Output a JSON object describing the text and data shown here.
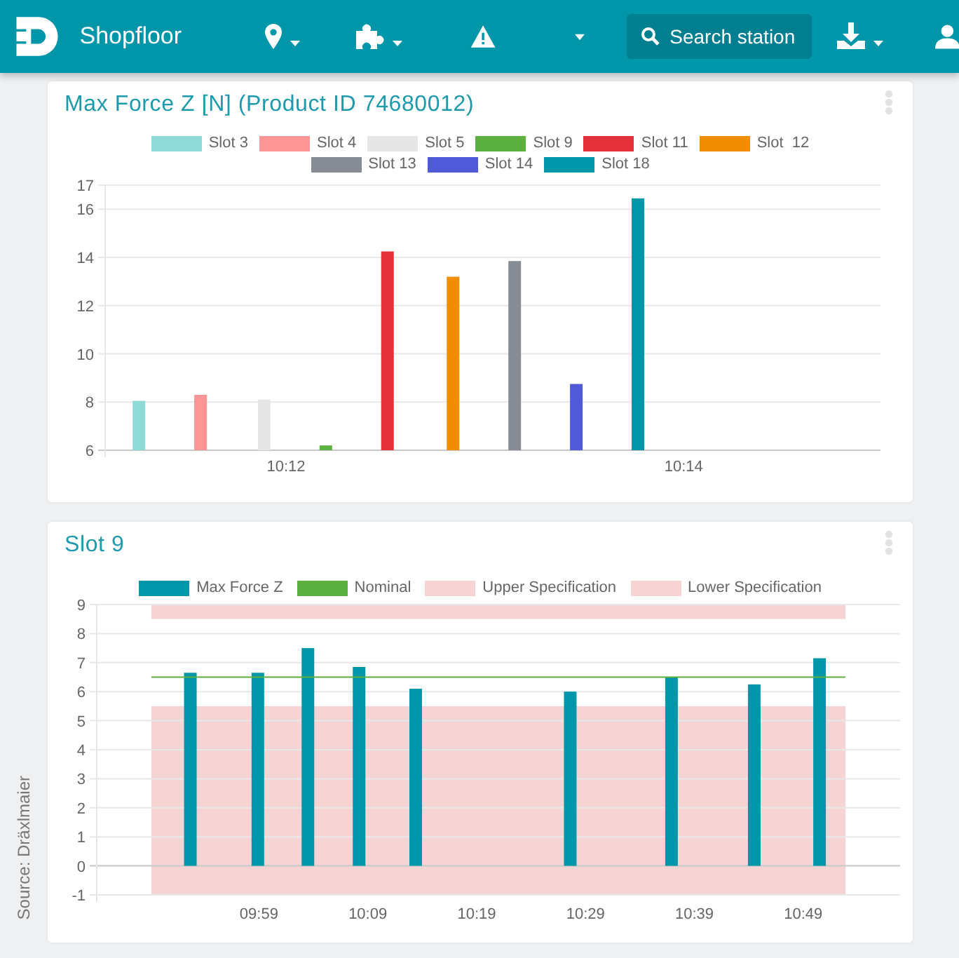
{
  "navbar": {
    "brand": "Shopfloor",
    "search": {
      "placeholder": "Search station"
    }
  },
  "cards": [
    {
      "title": "Max Force Z [N] (Product ID 74680012)",
      "chart_data": {
        "type": "bar",
        "x": [
          611.26,
          611.57,
          611.89,
          612.2,
          612.51,
          612.84,
          613.15,
          613.46,
          613.77
        ],
        "xlim": [
          611.09,
          614.99
        ],
        "ylim": [
          6,
          17
        ],
        "grid": true,
        "yticks": [
          6,
          8,
          10,
          12,
          14,
          16,
          17
        ],
        "xticks": [
          {
            "value": 612,
            "label": "10:12"
          },
          {
            "value": 614,
            "label": "10:14"
          }
        ],
        "series": [
          {
            "name": "Slot 3",
            "color": "#8fd9d6",
            "values": [
              8.05,
              null,
              null,
              null,
              null,
              null,
              null,
              null,
              null
            ]
          },
          {
            "name": "Slot 4",
            "color": "#fc9596",
            "values": [
              null,
              8.3,
              null,
              null,
              null,
              null,
              null,
              null,
              null
            ]
          },
          {
            "name": "Slot 5",
            "color": "#e6e6e6",
            "values": [
              null,
              null,
              8.1,
              null,
              null,
              null,
              null,
              null,
              null
            ]
          },
          {
            "name": "Slot 9",
            "color": "#5cb040",
            "values": [
              null,
              null,
              null,
              6.2,
              null,
              null,
              null,
              null,
              null
            ]
          },
          {
            "name": "Slot 11",
            "color": "#e4303a",
            "values": [
              null,
              null,
              null,
              null,
              14.25,
              null,
              null,
              null,
              null
            ]
          },
          {
            "name": "Slot  12",
            "color": "#f28c00",
            "values": [
              null,
              null,
              null,
              null,
              null,
              13.2,
              null,
              null,
              null
            ]
          },
          {
            "name": "Slot 13",
            "color": "#878c94",
            "values": [
              null,
              null,
              null,
              null,
              null,
              null,
              13.85,
              null,
              null
            ]
          },
          {
            "name": "Slot 14",
            "color": "#5059d8",
            "values": [
              null,
              null,
              null,
              null,
              null,
              null,
              null,
              8.75,
              null
            ]
          },
          {
            "name": "Slot 18",
            "color": "#0096aa",
            "values": [
              null,
              null,
              null,
              null,
              null,
              null,
              null,
              null,
              16.45
            ]
          }
        ]
      }
    },
    {
      "title": "Slot 9",
      "chart_data": {
        "type": "bar",
        "x": [
          592.7,
          598.9,
          603.5,
          608.2,
          613.4,
          627.6,
          636.9,
          644.5,
          650.5
        ],
        "xlim": [
          584.1,
          657.9
        ],
        "ylim": [
          -1,
          9
        ],
        "yticks": [
          -1,
          0,
          1,
          2,
          3,
          4,
          5,
          6,
          7,
          8,
          9
        ],
        "xticks": [
          {
            "value": 599,
            "label": "09:59"
          },
          {
            "value": 609,
            "label": "10:09"
          },
          {
            "value": 619,
            "label": "10:19"
          },
          {
            "value": 629,
            "label": "10:29"
          },
          {
            "value": 639,
            "label": "10:39"
          },
          {
            "value": 649,
            "label": "10:49"
          }
        ],
        "series": [
          {
            "name": "Max Force Z",
            "color": "#0096aa",
            "values": [
              6.65,
              6.65,
              7.5,
              6.85,
              6.1,
              6.0,
              6.5,
              6.25,
              7.15
            ]
          }
        ],
        "grid": true,
        "ref_lines": [
          {
            "label": "Nominal",
            "color": "#5cb040",
            "axis": "y",
            "value": 6.5
          }
        ],
        "bands": [
          {
            "label": "Upper Specification",
            "color": "#f7d4d4",
            "axis": "y",
            "from": 8.5,
            "to": 9
          },
          {
            "label": "Lower Specification",
            "color": "#f7d4d4",
            "axis": "y",
            "from": -1,
            "to": 5.5
          }
        ]
      }
    }
  ],
  "source_note": "Source: Dräxlmaier"
}
